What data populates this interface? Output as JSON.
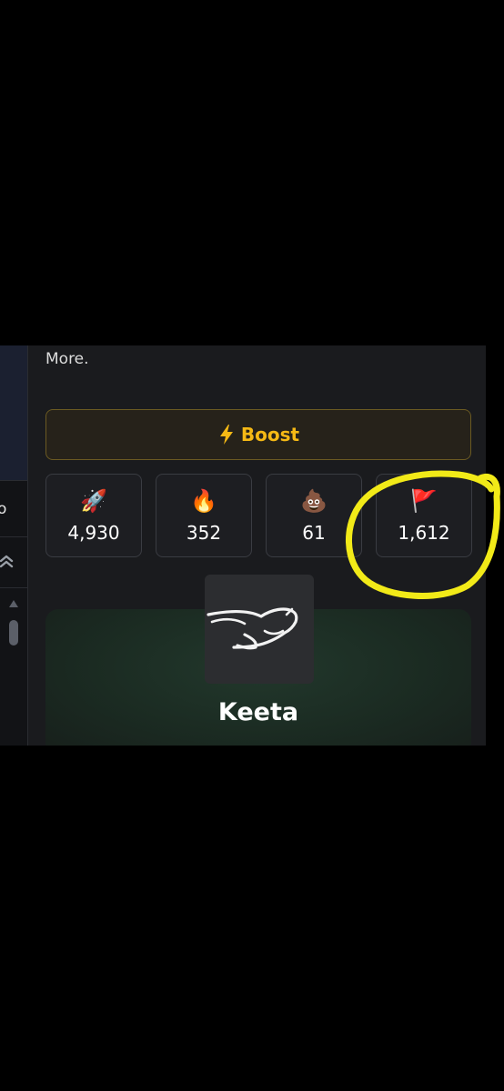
{
  "left_panel": {
    "clipped_text": "o"
  },
  "description_tail": "More.",
  "boost": {
    "label": "Boost",
    "icon": "lightning-icon",
    "color": "#f5b915"
  },
  "reactions": [
    {
      "name": "rocket",
      "emoji": "🚀",
      "count": "4,930"
    },
    {
      "name": "fire",
      "emoji": "🔥",
      "count": "352"
    },
    {
      "name": "poop",
      "emoji": "💩",
      "count": "61"
    },
    {
      "name": "flag",
      "emoji": "🚩",
      "count": "1,612"
    }
  ],
  "token": {
    "name": "Keeta",
    "logo": "cheetah-logo"
  },
  "annotation": {
    "shape": "hand-drawn-circle",
    "color": "#f2ea18",
    "target": "flag reaction"
  }
}
